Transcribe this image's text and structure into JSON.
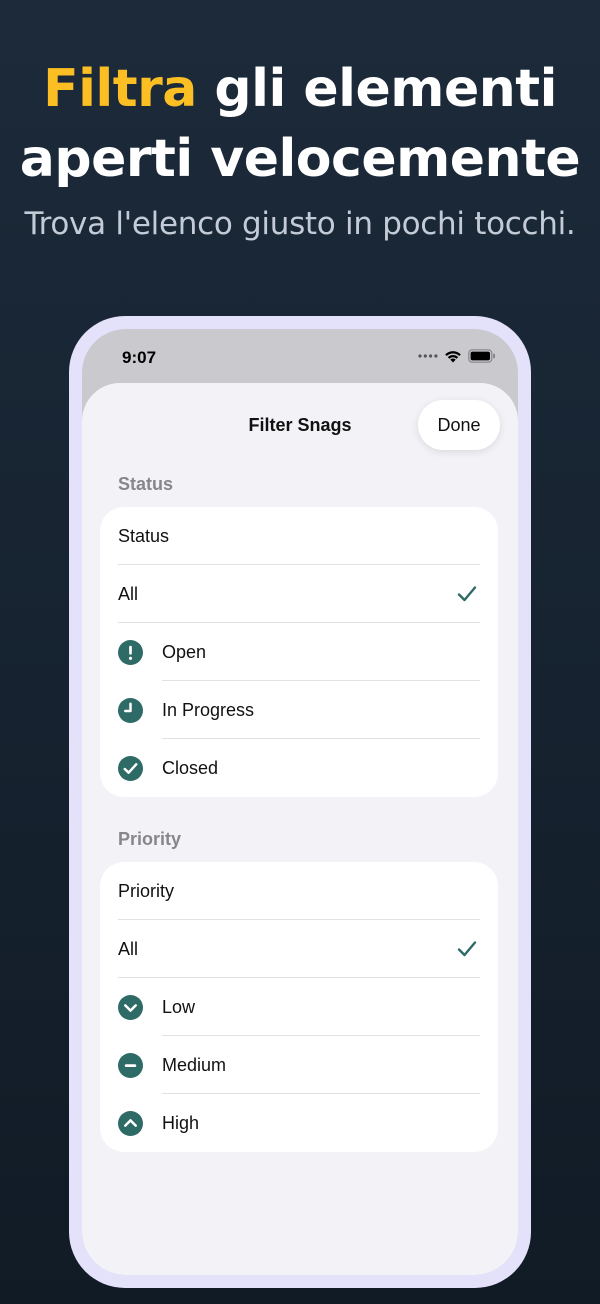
{
  "hero": {
    "title_accent": "Filtra",
    "title_rest_line1": " gli elementi",
    "title_line2": "aperti velocemente",
    "subtitle": "Trova l'elenco giusto in pochi tocchi."
  },
  "colors": {
    "accent": "#fbbf24",
    "icon_teal": "#2f6b66",
    "background": "#1c2a3a"
  },
  "status_bar": {
    "time": "9:07",
    "icons": [
      "cellular-dots-icon",
      "wifi-icon",
      "battery-icon"
    ]
  },
  "sheet": {
    "title": "Filter Snags",
    "done_label": "Done"
  },
  "status_section": {
    "header": "Status",
    "picker_label": "Status",
    "options": [
      {
        "label": "All",
        "icon": "",
        "selected": true
      },
      {
        "label": "Open",
        "icon": "exclamation-circle-icon",
        "selected": false
      },
      {
        "label": "In Progress",
        "icon": "clock-icon",
        "selected": false
      },
      {
        "label": "Closed",
        "icon": "checkmark-circle-icon",
        "selected": false
      }
    ]
  },
  "priority_section": {
    "header": "Priority",
    "picker_label": "Priority",
    "options": [
      {
        "label": "All",
        "icon": "",
        "selected": true
      },
      {
        "label": "Low",
        "icon": "chevron-down-circle-icon",
        "selected": false
      },
      {
        "label": "Medium",
        "icon": "minus-circle-icon",
        "selected": false
      },
      {
        "label": "High",
        "icon": "chevron-up-circle-icon",
        "selected": false
      }
    ]
  }
}
